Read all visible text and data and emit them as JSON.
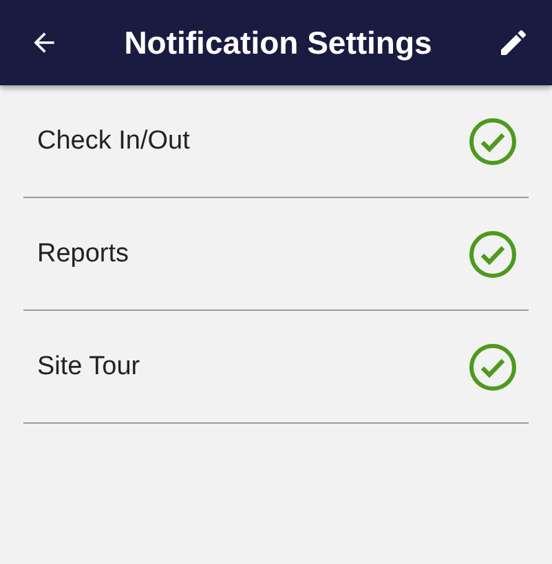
{
  "app_bar": {
    "title": "Notification Settings"
  },
  "items": [
    {
      "label": "Check In/Out",
      "checked": true
    },
    {
      "label": "Reports",
      "checked": true
    },
    {
      "label": "Site Tour",
      "checked": true
    }
  ]
}
